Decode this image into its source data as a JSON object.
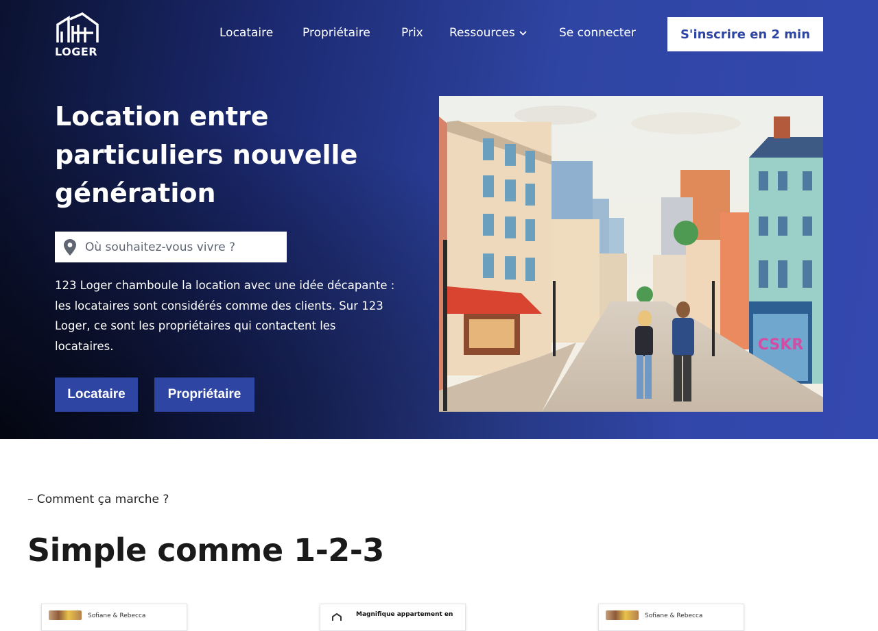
{
  "brand": {
    "name": "LOGER"
  },
  "nav": {
    "items": [
      {
        "label": "Locataire"
      },
      {
        "label": "Propriétaire"
      },
      {
        "label": "Prix"
      },
      {
        "label": "Ressources"
      },
      {
        "label": "Se connecter"
      }
    ],
    "signup_label": "S'inscrire en 2 min"
  },
  "hero": {
    "title": "Location entre particuliers nouvelle génération",
    "search_placeholder": "Où souhaitez-vous vivre ?",
    "description": "123 Loger chamboule la location avec une idée décapante : les locataires sont considérés comme des clients. Sur 123 Loger, ce sont les propriétaires qui contactent les locataires.",
    "btn_locataire": "Locataire",
    "btn_proprietaire": "Propriétaire",
    "illustration_graffiti": "CSKR"
  },
  "section": {
    "eyebrow": "– Comment ça marche ?",
    "title": "Simple comme 1-2-3"
  },
  "cards": [
    {
      "text": "Sofiane & Rebecca"
    },
    {
      "text": "Magnifique appartement en"
    },
    {
      "text": "Sofiane & Rebecca"
    }
  ],
  "colors": {
    "brand_blue": "#2f45a3",
    "hero_dark": "#0b1230",
    "white": "#ffffff"
  },
  "icons": {
    "logo": "house-logo-icon",
    "search": "map-pin-icon",
    "dropdown": "chevron-down-icon"
  }
}
